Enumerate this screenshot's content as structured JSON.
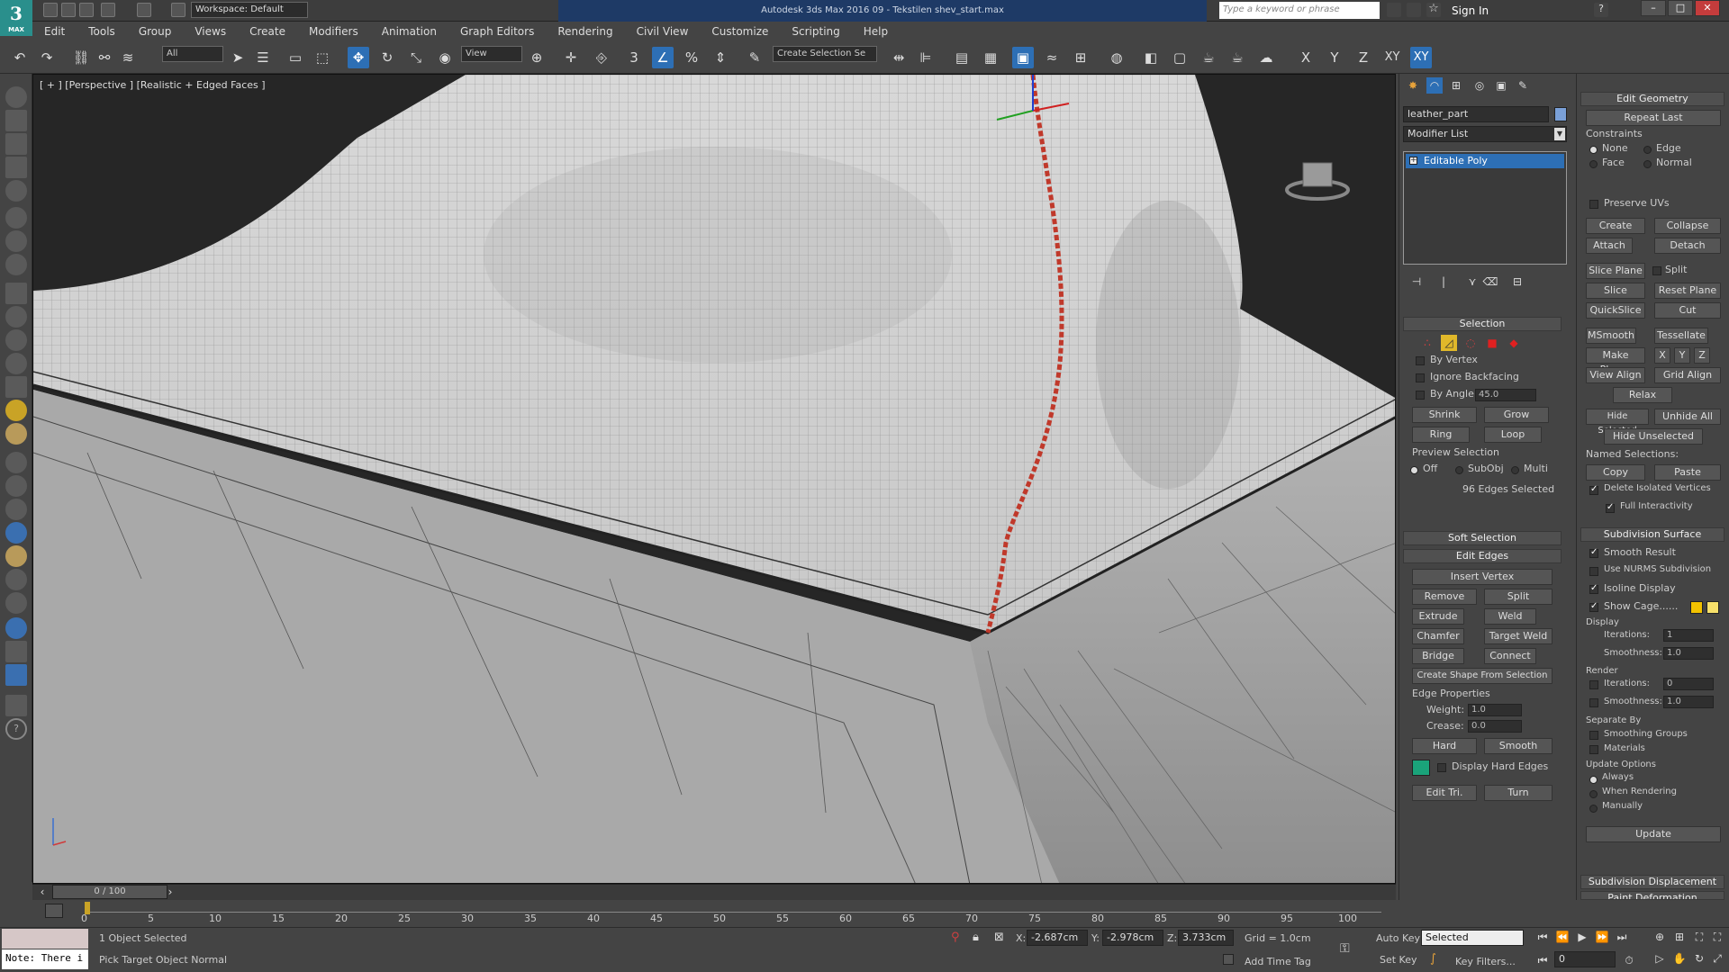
{
  "titlebar": {
    "logo": "3",
    "logo_sub": "MAX",
    "workspace": "Workspace: Default",
    "app_title": "Autodesk 3ds Max 2016     09 - Tekstilen shev_start.max",
    "search_placeholder": "Type a keyword or phrase",
    "sign_in": "Sign In"
  },
  "menu": [
    "Edit",
    "Tools",
    "Group",
    "Views",
    "Create",
    "Modifiers",
    "Animation",
    "Graph Editors",
    "Rendering",
    "Civil View",
    "Customize",
    "Scripting",
    "Help"
  ],
  "toolbar": {
    "selection_filter": "All",
    "ref_coord": "View",
    "selection_set": "Create Selection Se",
    "axis_x": "X",
    "axis_y": "Y",
    "axis_z": "Z",
    "axis_xy": "XY",
    "axis_xy2": "XY",
    "snap_3": "3",
    "percent_snap": "%"
  },
  "viewport": {
    "label": "[ + ] [Perspective ] [Realistic + Edged Faces ]"
  },
  "command_panel": {
    "object_name": "leather_part",
    "modifier_list": "Modifier List",
    "stack_item": "Editable Poly",
    "selection": {
      "header": "Selection",
      "by_vertex": "By Vertex",
      "ignore_backfacing": "Ignore Backfacing",
      "by_angle": "By Angle:",
      "angle_value": "45.0",
      "shrink": "Shrink",
      "grow": "Grow",
      "ring": "Ring",
      "loop": "Loop",
      "preview_selection": "Preview Selection",
      "off": "Off",
      "subobj": "SubObj",
      "multi": "Multi",
      "status": "96 Edges Selected"
    },
    "soft_selection": "Soft Selection",
    "edit_edges": {
      "header": "Edit Edges",
      "insert_vertex": "Insert Vertex",
      "remove": "Remove",
      "split": "Split",
      "extrude": "Extrude",
      "weld": "Weld",
      "chamfer": "Chamfer",
      "target_weld": "Target Weld",
      "bridge": "Bridge",
      "connect": "Connect",
      "create_shape": "Create Shape From Selection",
      "edge_properties": "Edge Properties",
      "weight_label": "Weight:",
      "weight": "1.0",
      "crease_label": "Crease:",
      "crease": "0.0",
      "hard": "Hard",
      "smooth": "Smooth",
      "display_hard_edges": "Display Hard Edges",
      "edit_tri": "Edit Tri.",
      "turn": "Turn"
    }
  },
  "edit_geometry": {
    "header": "Edit Geometry",
    "repeat_last": "Repeat Last",
    "constraints": "Constraints",
    "none": "None",
    "edge": "Edge",
    "face": "Face",
    "normal": "Normal",
    "preserve_uvs": "Preserve UVs",
    "create": "Create",
    "collapse": "Collapse",
    "attach": "Attach",
    "detach": "Detach",
    "slice_plane": "Slice Plane",
    "split": "Split",
    "slice": "Slice",
    "reset_plane": "Reset Plane",
    "quickslice": "QuickSlice",
    "cut": "Cut",
    "msmooth": "MSmooth",
    "tessellate": "Tessellate",
    "make_planar": "Make Planar",
    "x": "X",
    "y": "Y",
    "z": "Z",
    "view_align": "View Align",
    "grid_align": "Grid Align",
    "relax": "Relax",
    "hide_selected": "Hide Selected",
    "unhide_all": "Unhide All",
    "hide_unselected": "Hide Unselected",
    "named_selections": "Named Selections:",
    "copy": "Copy",
    "paste": "Paste",
    "delete_isolated": "Delete Isolated Vertices",
    "full_interactivity": "Full Interactivity"
  },
  "subdivision_surface": {
    "header": "Subdivision Surface",
    "smooth_result": "Smooth Result",
    "use_nurms": "Use NURMS Subdivision",
    "isoline_display": "Isoline Display",
    "show_cage": "Show Cage......",
    "display": "Display",
    "iterations_label": "Iterations:",
    "display_iterations": "1",
    "smoothness_label": "Smoothness:",
    "display_smoothness": "1.0",
    "render": "Render",
    "render_iterations": "0",
    "render_smoothness": "1.0",
    "separate_by": "Separate By",
    "smoothing_groups": "Smoothing Groups",
    "materials": "Materials",
    "update_options": "Update Options",
    "always": "Always",
    "when_rendering": "When Rendering",
    "manually": "Manually",
    "update": "Update",
    "subdivision_displacement": "Subdivision Displacement",
    "paint_deformation": "Paint Deformation"
  },
  "timeline": {
    "frame": "0 / 100",
    "ticks": [
      "0",
      "5",
      "10",
      "15",
      "20",
      "25",
      "30",
      "35",
      "40",
      "45",
      "50",
      "55",
      "60",
      "65",
      "70",
      "75",
      "80",
      "85",
      "90",
      "95",
      "100"
    ]
  },
  "status": {
    "maxscript": "Note: There i",
    "objects_selected": "1 Object Selected",
    "prompt": "Pick Target Object Normal",
    "x_label": "X:",
    "x": "-2.687cm",
    "y_label": "Y:",
    "y": "-2.978cm",
    "z_label": "Z:",
    "z": "3.733cm",
    "grid": "Grid = 1.0cm",
    "add_time_tag": "Add Time Tag",
    "auto_key": "Auto Key",
    "set_key": "Set Key",
    "selected": "Selected",
    "key_filters": "Key Filters...",
    "frame_value": "0"
  },
  "colors": {
    "accent": "#2d6fb5",
    "selection_edge": "#c0392b",
    "hard_edge_swatch": "#1aa37a",
    "cage_color": "#f2c200"
  }
}
